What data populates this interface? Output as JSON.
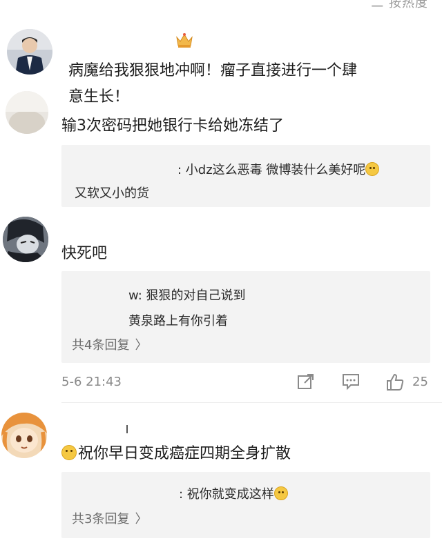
{
  "header": {
    "truncated_hint": "二 按热度"
  },
  "comments": [
    {
      "text_line1": "病魔给我狠狠地冲啊！瘤子直接进行一个肆",
      "text_line2": "意生长！"
    },
    {
      "text": "输3次密码把她银行卡给她冻结了",
      "reply": {
        "line1": ": 小dz这么恶毒  微博装什么美好呢",
        "line2": "又软又小的货"
      }
    },
    {
      "text": "快死吧",
      "reply": {
        "line1": "w: 狠狠的对自己说到",
        "line2": "黄泉路上有你引着",
        "more": "共4条回复"
      },
      "time": "5-6 21:43",
      "like_count": "25"
    },
    {
      "text": "祝你早日变成癌症四期全身扩散",
      "reply": {
        "line1": ": 祝你就变成这样",
        "more": "共3条回复"
      }
    }
  ],
  "icons": {
    "crown": "crown-icon",
    "share": "share-icon",
    "comment": "comment-icon",
    "like": "thumbs-up-icon",
    "chevron": "chevron-right-icon",
    "emoji": "smiley-emoji-icon"
  },
  "chevron_glyph": "〉"
}
